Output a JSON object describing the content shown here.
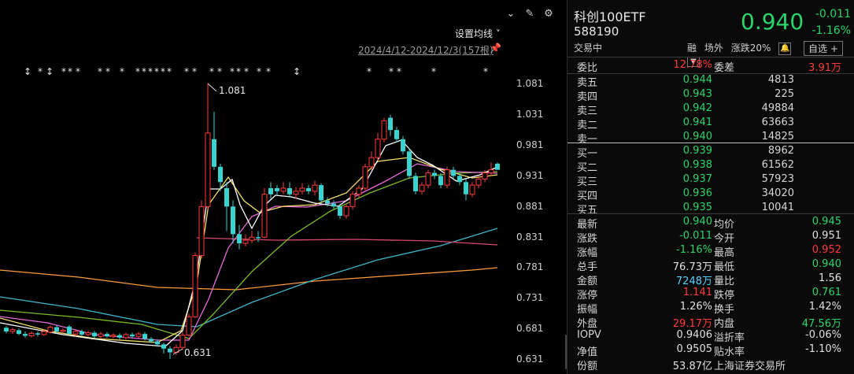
{
  "toolbar": {
    "ma_settings": "设置均线 ˅",
    "range_label": "2024/4/12-2024/12/3(157根)"
  },
  "axis": {
    "ylabels": [
      "1.081",
      "1.031",
      "0.981",
      "0.931",
      "0.881",
      "0.831",
      "0.781",
      "0.731",
      "0.681",
      "0.631"
    ]
  },
  "annotations": {
    "high_label": "1.081",
    "low_label": "0.631"
  },
  "header": {
    "name": "科创100ETF",
    "code": "588190",
    "status": "交易中",
    "price": "0.940",
    "change": "-0.011",
    "change_pct": "-1.16%",
    "tag1": "融",
    "tag2": "场外",
    "tag3": "涨跌20%",
    "bell": "🔔",
    "watch": "自选 +",
    "watch_arrow": "▼"
  },
  "ratio": {
    "label1": "委比",
    "value1": "12.78%",
    "label2": "委差",
    "value2": "3.91万"
  },
  "asks": [
    {
      "label": "卖五",
      "price": "0.944",
      "vol": "4813"
    },
    {
      "label": "卖四",
      "price": "0.943",
      "vol": "225"
    },
    {
      "label": "卖三",
      "price": "0.942",
      "vol": "49884"
    },
    {
      "label": "卖二",
      "price": "0.941",
      "vol": "63663"
    },
    {
      "label": "卖一",
      "price": "0.940",
      "vol": "14825"
    }
  ],
  "bids": [
    {
      "label": "买一",
      "price": "0.939",
      "vol": "8962"
    },
    {
      "label": "买二",
      "price": "0.938",
      "vol": "61562"
    },
    {
      "label": "买三",
      "price": "0.937",
      "vol": "57923"
    },
    {
      "label": "买四",
      "price": "0.936",
      "vol": "34020"
    },
    {
      "label": "买五",
      "price": "0.935",
      "vol": "10041"
    }
  ],
  "stats": [
    {
      "l1": "最新",
      "v1": "0.940",
      "c1": "green",
      "l2": "均价",
      "v2": "0.945",
      "c2": "green"
    },
    {
      "l1": "涨跌",
      "v1": "-0.011",
      "c1": "green",
      "l2": "今开",
      "v2": "0.951",
      "c2": "white"
    },
    {
      "l1": "涨幅",
      "v1": "-1.16%",
      "c1": "green",
      "l2": "最高",
      "v2": "0.952",
      "c2": "red"
    },
    {
      "l1": "总手",
      "v1": "76.73万",
      "c1": "white",
      "l2": "最低",
      "v2": "0.940",
      "c2": "green"
    },
    {
      "l1": "金额",
      "v1": "7248万",
      "c1": "cyan",
      "l2": "量比",
      "v2": "1.56",
      "c2": "white"
    },
    {
      "l1": "涨停",
      "v1": "1.141",
      "c1": "red",
      "l2": "跌停",
      "v2": "0.761",
      "c2": "green"
    },
    {
      "l1": "振幅",
      "v1": "1.26%",
      "c1": "white",
      "l2": "换手",
      "v2": "1.42%",
      "c2": "white"
    },
    {
      "l1": "外盘",
      "v1": "29.17万",
      "c1": "red",
      "l2": "内盘",
      "v2": "47.56万",
      "c2": "green"
    },
    {
      "l1": "IOPV",
      "v1": "0.9406",
      "c1": "white",
      "l2": "溢折率",
      "v2": "-0.06%",
      "c2": "white"
    },
    {
      "l1": "净值",
      "v1": "0.9505",
      "c1": "white",
      "l2": "贴水率",
      "v2": "-1.10%",
      "c2": "white"
    },
    {
      "l1": "份额",
      "v1": "53.87亿",
      "c1": "white",
      "l2": "上海证券交易所",
      "v2": "",
      "c2": "white"
    }
  ],
  "colors": {
    "up": "#ff3b3b",
    "down": "#2bd56b",
    "cyan": "#5ad2ff",
    "bg": "#000000"
  }
}
